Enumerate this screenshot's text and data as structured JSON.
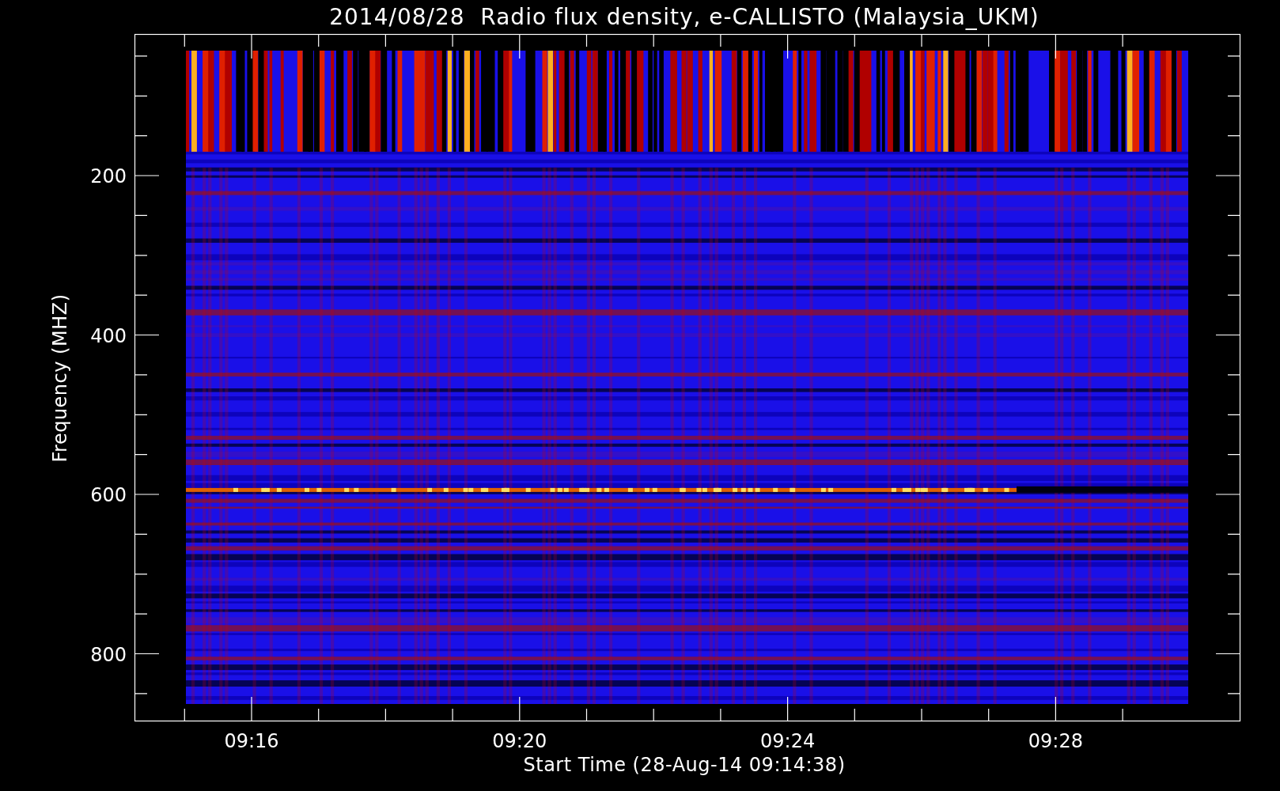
{
  "title": "2014/08/28  Radio flux density, e-CALLISTO (Malaysia_UKM)",
  "y_axis": {
    "label": "Frequency (MHZ)",
    "tick_labels": [
      "200",
      "400",
      "600",
      "800"
    ]
  },
  "x_axis": {
    "label": "Start Time (28-Aug-14 09:14:38)",
    "tick_labels": [
      "09:16",
      "09:20",
      "09:24",
      "09:28"
    ]
  }
}
